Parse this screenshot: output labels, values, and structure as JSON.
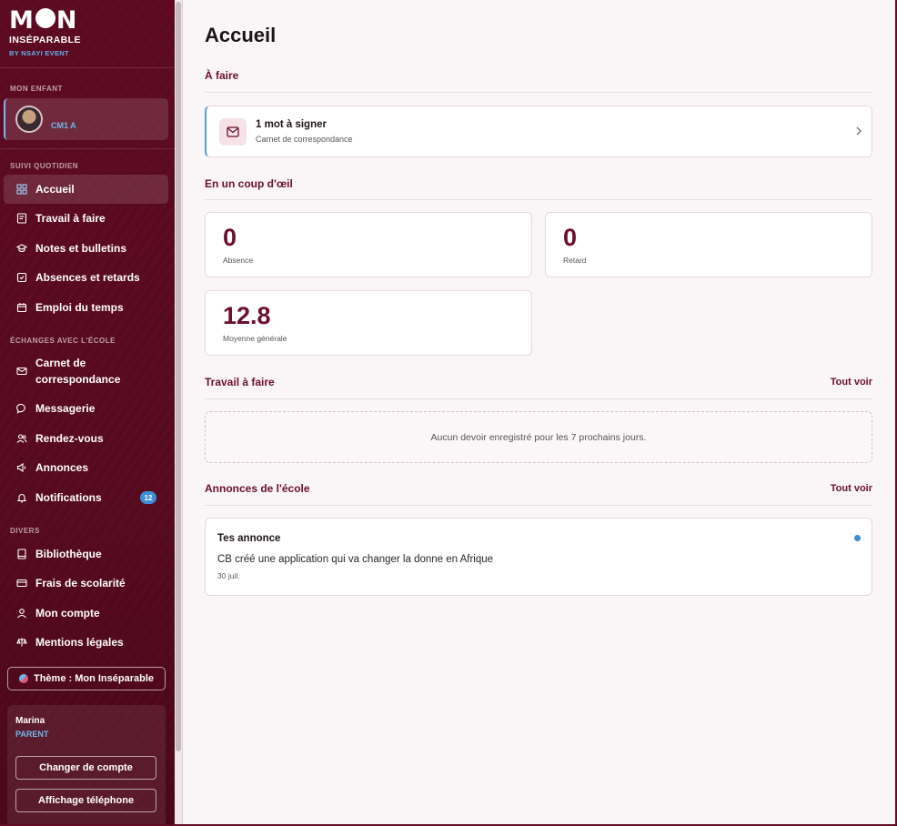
{
  "brand": {
    "name_part1": "M",
    "name_part2": "N",
    "subtitle": "INSÉPARABLE",
    "by": "BY NSAYI EVENT"
  },
  "sidebar": {
    "child_section": "MON ENFANT",
    "child": {
      "name": "",
      "class": "CM1 A"
    },
    "sections": [
      {
        "title": "SUIVI QUOTIDIEN"
      },
      {
        "title": "ÉCHANGES AVEC L'ÉCOLE"
      },
      {
        "title": "DIVERS"
      }
    ],
    "items": [
      {
        "label": "Accueil",
        "icon": "dashboard-icon",
        "active": true
      },
      {
        "label": "Travail à faire",
        "icon": "homework-icon"
      },
      {
        "label": "Notes et bulletins",
        "icon": "graduation-cap-icon"
      },
      {
        "label": "Absences et retards",
        "icon": "check-square-icon"
      },
      {
        "label": "Emploi du temps",
        "icon": "calendar-icon"
      },
      {
        "label": "Carnet de\ncorrespondance",
        "icon": "mail-icon"
      },
      {
        "label": "Messagerie",
        "icon": "chat-bubble-icon"
      },
      {
        "label": "Rendez-vous",
        "icon": "users-icon"
      },
      {
        "label": "Annonces",
        "icon": "megaphone-icon"
      },
      {
        "label": "Notifications",
        "icon": "bell-icon",
        "badge": "12"
      },
      {
        "label": "Bibliothèque",
        "icon": "book-icon"
      },
      {
        "label": "Frais de scolarité",
        "icon": "credit-card-icon"
      },
      {
        "label": "Mon compte",
        "icon": "user-icon"
      },
      {
        "label": "Mentions légales",
        "icon": "scale-icon"
      }
    ],
    "theme_button": "Thème : Mon Inséparable",
    "user": {
      "name": "Marina",
      "role": "PARENT",
      "switch_account": "Changer de compte",
      "phone_view": "Affichage téléphone"
    }
  },
  "main": {
    "title": "Accueil",
    "todo_section": "À faire",
    "todo_item": {
      "title": "1 mot à signer",
      "subtitle": "Carnet de correspondance"
    },
    "glance_section": "En un coup d'œil",
    "stats": [
      {
        "value": "0",
        "label": "Absence"
      },
      {
        "value": "0",
        "label": "Retard"
      },
      {
        "value": "12.8",
        "label": "Moyenne générale"
      }
    ],
    "homework_section": "Travail à faire",
    "homework_link": "Tout voir",
    "homework_empty": "Aucun devoir enregistré pour les 7 prochains jours.",
    "announcements_section": "Annonces de l'école",
    "announcements_link": "Tout voir",
    "announcement": {
      "title": "Tes annonce",
      "text": "CB créé une application qui va changer la donne en Afrique",
      "date": "30 juil."
    }
  },
  "colors": {
    "brand": "#6b0f2c",
    "sidebar_bg": "#5e0c24",
    "accent_blue": "#3c8fd6",
    "background": "#faf6f7"
  }
}
